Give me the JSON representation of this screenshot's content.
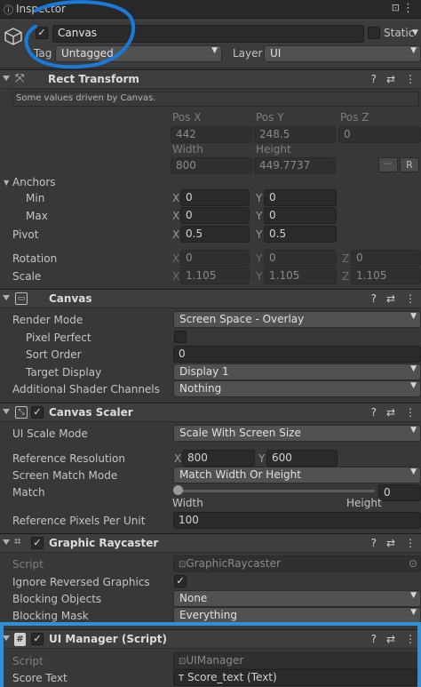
{
  "tab": {
    "title": "Inspector"
  },
  "go": {
    "active": "✓",
    "name": "Canvas",
    "static_label": "Static",
    "tag_label": "Tag",
    "tag_value": "Untagged",
    "layer_label": "Layer",
    "layer_value": "UI"
  },
  "rect": {
    "title": "Rect Transform",
    "driven_note": "Some values driven by Canvas.",
    "pos_x_label": "Pos X",
    "pos_y_label": "Pos Y",
    "pos_z_label": "Pos Z",
    "pos_x": "442",
    "pos_y": "248.5",
    "pos_z": "0",
    "width_label": "Width",
    "height_label": "Height",
    "width": "800",
    "height": "449.7737",
    "r_button": "R",
    "anchors_label": "Anchors",
    "min_label": "Min",
    "max_label": "Max",
    "min_x": "0",
    "min_y": "0",
    "max_x": "0",
    "max_y": "0",
    "pivot_label": "Pivot",
    "pivot_x": "0.5",
    "pivot_y": "0.5",
    "rotation_label": "Rotation",
    "rot_x": "0",
    "rot_y": "0",
    "rot_z": "0",
    "scale_label": "Scale",
    "scale_x": "1.105",
    "scale_y": "1.105",
    "scale_z": "1.105",
    "ax_x": "X",
    "ax_y": "Y",
    "ax_z": "Z"
  },
  "canvas": {
    "title": "Canvas",
    "render_mode_label": "Render Mode",
    "render_mode": "Screen Space - Overlay",
    "pixel_perfect_label": "Pixel Perfect",
    "sort_order_label": "Sort Order",
    "sort_order": "0",
    "target_display_label": "Target Display",
    "target_display": "Display 1",
    "shader_channels_label": "Additional Shader Channels",
    "shader_channels": "Nothing"
  },
  "scaler": {
    "title": "Canvas Scaler",
    "ui_scale_mode_label": "UI Scale Mode",
    "ui_scale_mode": "Scale With Screen Size",
    "ref_res_label": "Reference Resolution",
    "ref_x": "800",
    "ref_y": "600",
    "match_mode_label": "Screen Match Mode",
    "match_mode": "Match Width Or Height",
    "match_label": "Match",
    "match_value": "0",
    "match_fraction": 0,
    "width_label": "Width",
    "height_label": "Height",
    "ppu_label": "Reference Pixels Per Unit",
    "ppu": "100"
  },
  "raycaster": {
    "title": "Graphic Raycaster",
    "script_label": "Script",
    "script": "GraphicRaycaster",
    "ignore_reversed_label": "Ignore Reversed Graphics",
    "blocking_objects_label": "Blocking Objects",
    "blocking_objects": "None",
    "blocking_mask_label": "Blocking Mask",
    "blocking_mask": "Everything"
  },
  "uimanager": {
    "title": "UI Manager (Script)",
    "script_label": "Script",
    "script": "UIManager",
    "score_text_label": "Score Text",
    "score_text": "Score_text (Text)"
  },
  "icons": {
    "help": "?",
    "presets": "⇄",
    "menu": "⋮",
    "lock": "🔒",
    "kebab": "⋮",
    "check": "✓",
    "target": "⊙"
  },
  "colors": {
    "highlight": "#2f8fd8",
    "annotation": "#1a7ad9"
  }
}
